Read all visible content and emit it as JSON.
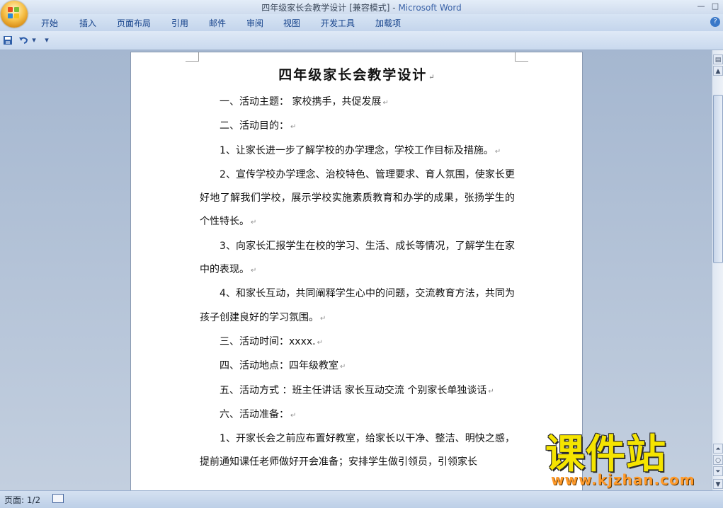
{
  "window": {
    "title_doc": "四年级家长会教学设计 [兼容模式]",
    "title_sep": " - ",
    "title_app": "Microsoft Word",
    "minimize": "—",
    "restore": "□"
  },
  "ribbon": {
    "tabs": [
      "开始",
      "插入",
      "页面布局",
      "引用",
      "邮件",
      "审阅",
      "视图",
      "开发工具",
      "加载项"
    ],
    "help": "?"
  },
  "qat": {
    "save_icon": "save-icon",
    "undo_icon": "undo-icon",
    "dropdown": "▾",
    "customize": "▾"
  },
  "document": {
    "title": "四年级家长会教学设计",
    "paragraphs": [
      "一、活动主题：    家校携手，共促发展",
      "二、活动目的：",
      "1、让家长进一步了解学校的办学理念，学校工作目标及措施。",
      "2、宣传学校办学理念、治校特色、管理要求、育人氛围，使家长更好地了解我们学校，展示学校实施素质教育和办学的成果，张扬学生的个性特长。",
      "3、向家长汇报学生在校的学习、生活、成长等情况，了解学生在家中的表现。",
      "4、和家长互动，共同阐释学生心中的问题，交流教育方法，共同为孩子创建良好的学习氛围。",
      "三、活动时间：xxxx.",
      "四、活动地点：四年级教室",
      "五、活动方式 ：班主任讲话    家长互动交流    个别家长单独谈话",
      "六、活动准备：",
      "1、开家长会之前应布置好教室，给家长以干净、整洁、明快之感，提前通知课任老师做好开会准备；安排学生做引领员，引领家长"
    ],
    "para_mark": "↵"
  },
  "status": {
    "page": "页面: 1/2"
  },
  "watermark": {
    "text": "课件站",
    "url": "www.kjzhan.com"
  },
  "colors": {
    "ribbon_text": "#15428b",
    "title_app": "#3b63a8",
    "watermark_yellow": "#f5e400"
  }
}
